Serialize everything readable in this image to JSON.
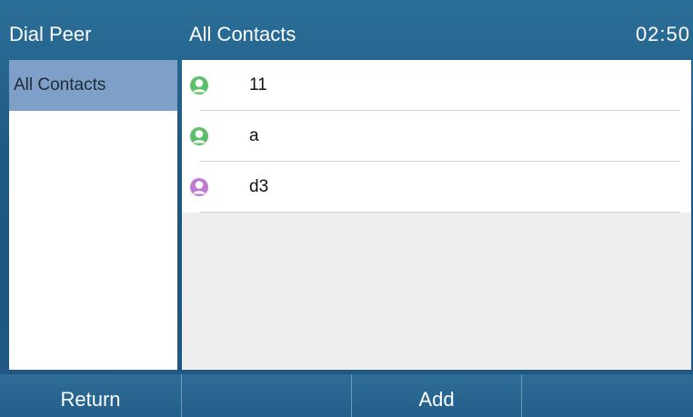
{
  "header": {
    "app_title": "Dial Peer",
    "section_title": "All Contacts",
    "clock": "02:50"
  },
  "sidebar": {
    "items": [
      {
        "label": "All Contacts",
        "active": true
      }
    ]
  },
  "contacts": [
    {
      "name": "11",
      "avatar_icon": "contact-avatar-icon",
      "avatar_color": "#5cc06a"
    },
    {
      "name": "a",
      "avatar_icon": "contact-avatar-icon",
      "avatar_color": "#5cc06a"
    },
    {
      "name": "d3",
      "avatar_icon": "contact-avatar-icon",
      "avatar_color": "#c07ad3"
    }
  ],
  "softkeys": [
    {
      "label": "Return"
    },
    {
      "label": ""
    },
    {
      "label": "Add"
    },
    {
      "label": ""
    }
  ],
  "colors": {
    "accent_blue": "#1f5a84",
    "active_item": "#7e9fc7"
  }
}
